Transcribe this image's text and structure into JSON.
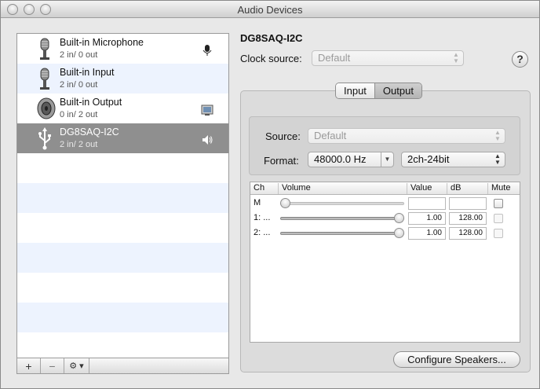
{
  "window": {
    "title": "Audio Devices"
  },
  "devices": [
    {
      "name": "Built-in Microphone",
      "io": "2 in/ 0 out",
      "icon": "microphone-icon",
      "badge": "microphone-badge-icon"
    },
    {
      "name": "Built-in Input",
      "io": "2 in/ 0 out",
      "icon": "microphone-icon",
      "badge": ""
    },
    {
      "name": "Built-in Output",
      "io": "0 in/ 2 out",
      "icon": "speaker-icon",
      "badge": "finder-badge-icon"
    },
    {
      "name": "DG8SAQ-I2C",
      "io": "2 in/ 2 out",
      "icon": "usb-icon",
      "badge": "speaker-volume-badge-icon",
      "selected": true
    }
  ],
  "list_toolbar": {
    "add": "+",
    "remove": "−",
    "action": "⚙ ▾"
  },
  "detail": {
    "device_title": "DG8SAQ-I2C",
    "clock_label": "Clock source:",
    "clock_value": "Default",
    "help": "?",
    "tabs": [
      {
        "label": "Input"
      },
      {
        "label": "Output",
        "active": true
      }
    ],
    "source_label": "Source:",
    "source_value": "Default",
    "format_label": "Format:",
    "format_value": "48000.0 Hz",
    "bits_value": "2ch-24bit",
    "configure_button": "Configure Speakers..."
  },
  "volume_table": {
    "headers": {
      "ch": "Ch",
      "volume": "Volume",
      "value": "Value",
      "db": "dB",
      "mute": "Mute"
    },
    "rows": [
      {
        "ch": "M",
        "level": 0.0,
        "value": "",
        "db": ""
      },
      {
        "ch": "1: ...",
        "level": 1.0,
        "value": "1.00",
        "db": "128.00"
      },
      {
        "ch": "2: ...",
        "level": 1.0,
        "value": "1.00",
        "db": "128.00"
      }
    ]
  }
}
